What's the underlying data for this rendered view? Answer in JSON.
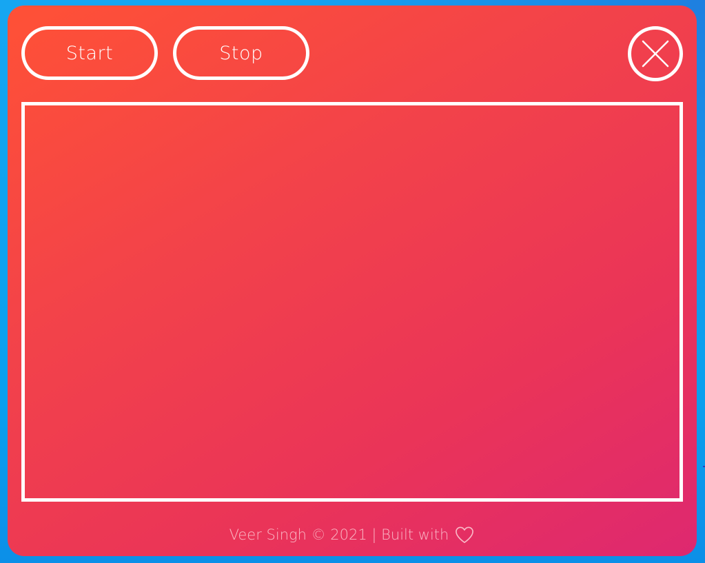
{
  "app": {
    "start_label": "Start",
    "stop_label": "Stop",
    "close_icon": "close-icon",
    "footer": {
      "credit": "Veer Singh © 2021 | Built with",
      "heart_icon": "heart-outline-icon"
    }
  },
  "colors": {
    "gradient_start": "#ff5136",
    "gradient_end": "#de2870",
    "outline": "#ffffff",
    "desktop": "#0aa0ee"
  }
}
